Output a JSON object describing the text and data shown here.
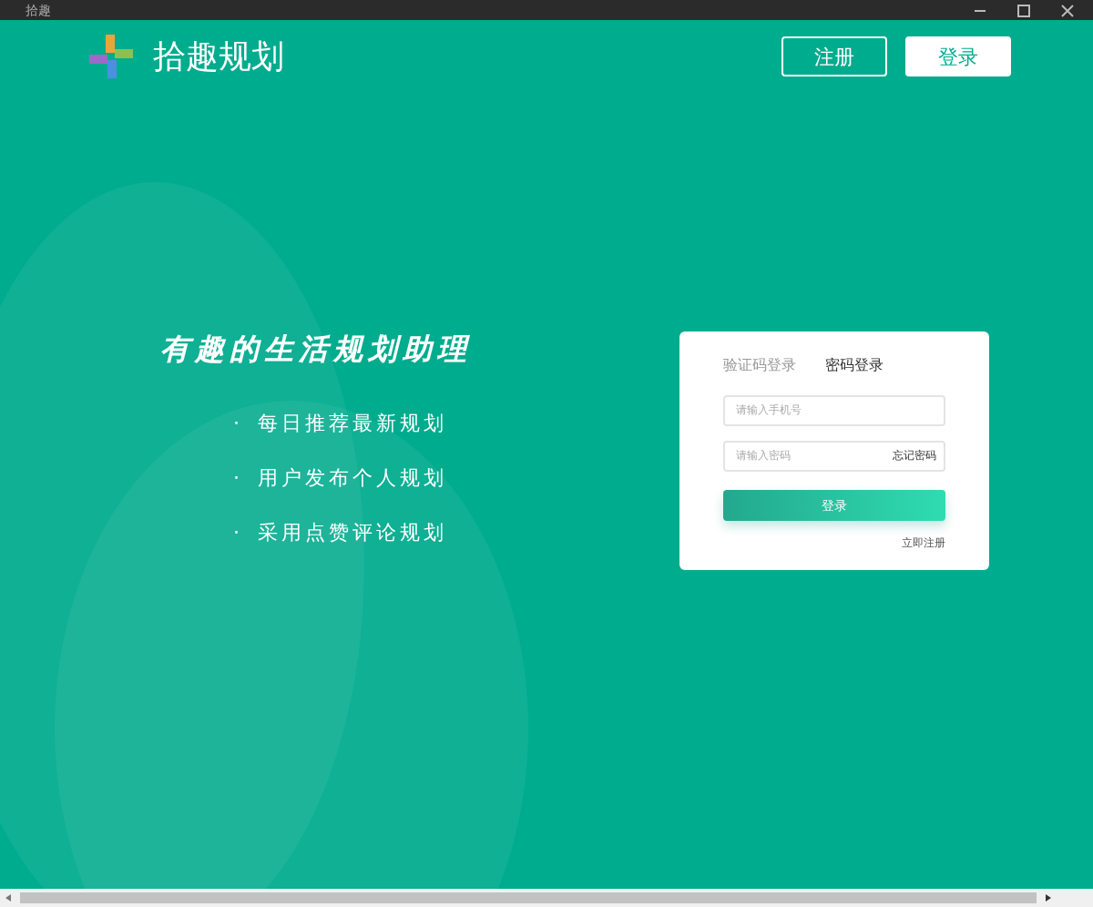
{
  "window": {
    "title": "拾趣"
  },
  "header": {
    "brand": "拾趣规划",
    "buttons": [
      {
        "label": "注册",
        "kind": "outline"
      },
      {
        "label": "登录",
        "kind": "solid"
      }
    ]
  },
  "hero": {
    "headline": "有趣的生活规划助理",
    "features": [
      {
        "bullet": "·",
        "text": "每日推荐最新规划"
      },
      {
        "bullet": "·",
        "text": "用户发布个人规划"
      },
      {
        "bullet": "·",
        "text": "采用点赞评论规划"
      }
    ]
  },
  "login": {
    "tabs": [
      {
        "label": "验证码登录",
        "selected": false
      },
      {
        "label": "密码登录",
        "selected": true
      }
    ],
    "phone": {
      "placeholder": "请输入手机号"
    },
    "password": {
      "placeholder": "请输入密码",
      "action": "忘记密码"
    },
    "submit": "登录",
    "register_link": "立即注册"
  }
}
